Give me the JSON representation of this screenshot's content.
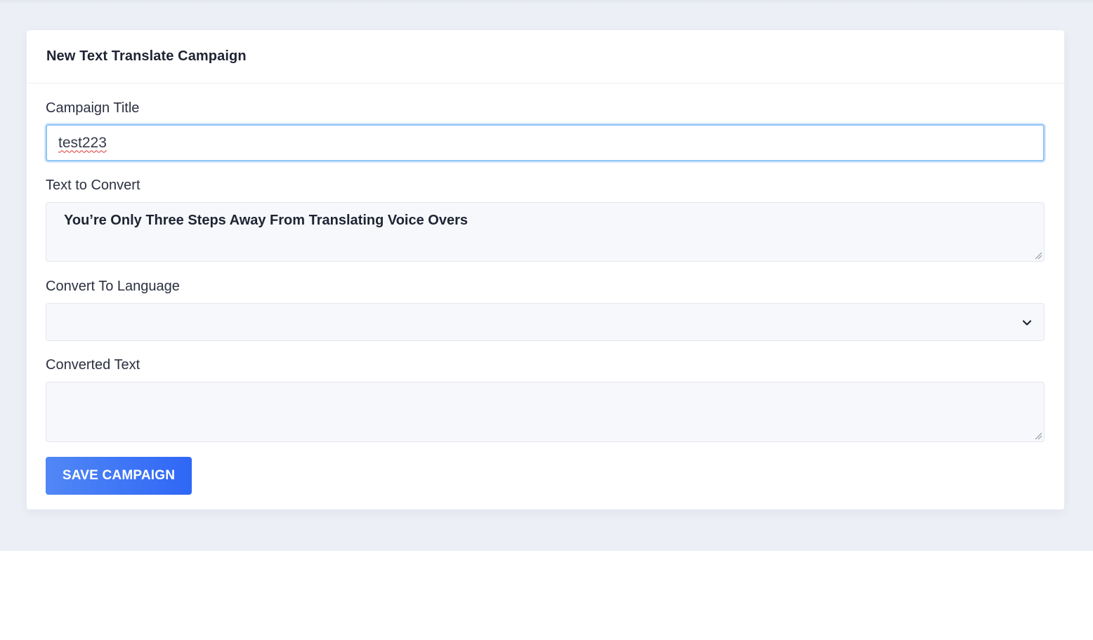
{
  "card": {
    "title": "New Text Translate Campaign"
  },
  "form": {
    "campaign_title": {
      "label": "Campaign Title",
      "value": "test223"
    },
    "text_to_convert": {
      "label": "Text to Convert",
      "value": "You’re Only Three Steps Away From Translating Voice Overs"
    },
    "convert_to_language": {
      "label": "Convert To Language",
      "selected": "",
      "icon": "chevron-down-icon"
    },
    "converted_text": {
      "label": "Converted Text",
      "value": ""
    },
    "save_label": "SAVE CAMPAIGN"
  },
  "colors": {
    "page_background": "#eceff5",
    "card_background": "#ffffff",
    "focus_border": "#8fc3f5",
    "button_start": "#5187f5",
    "button_end": "#2f67f6"
  }
}
